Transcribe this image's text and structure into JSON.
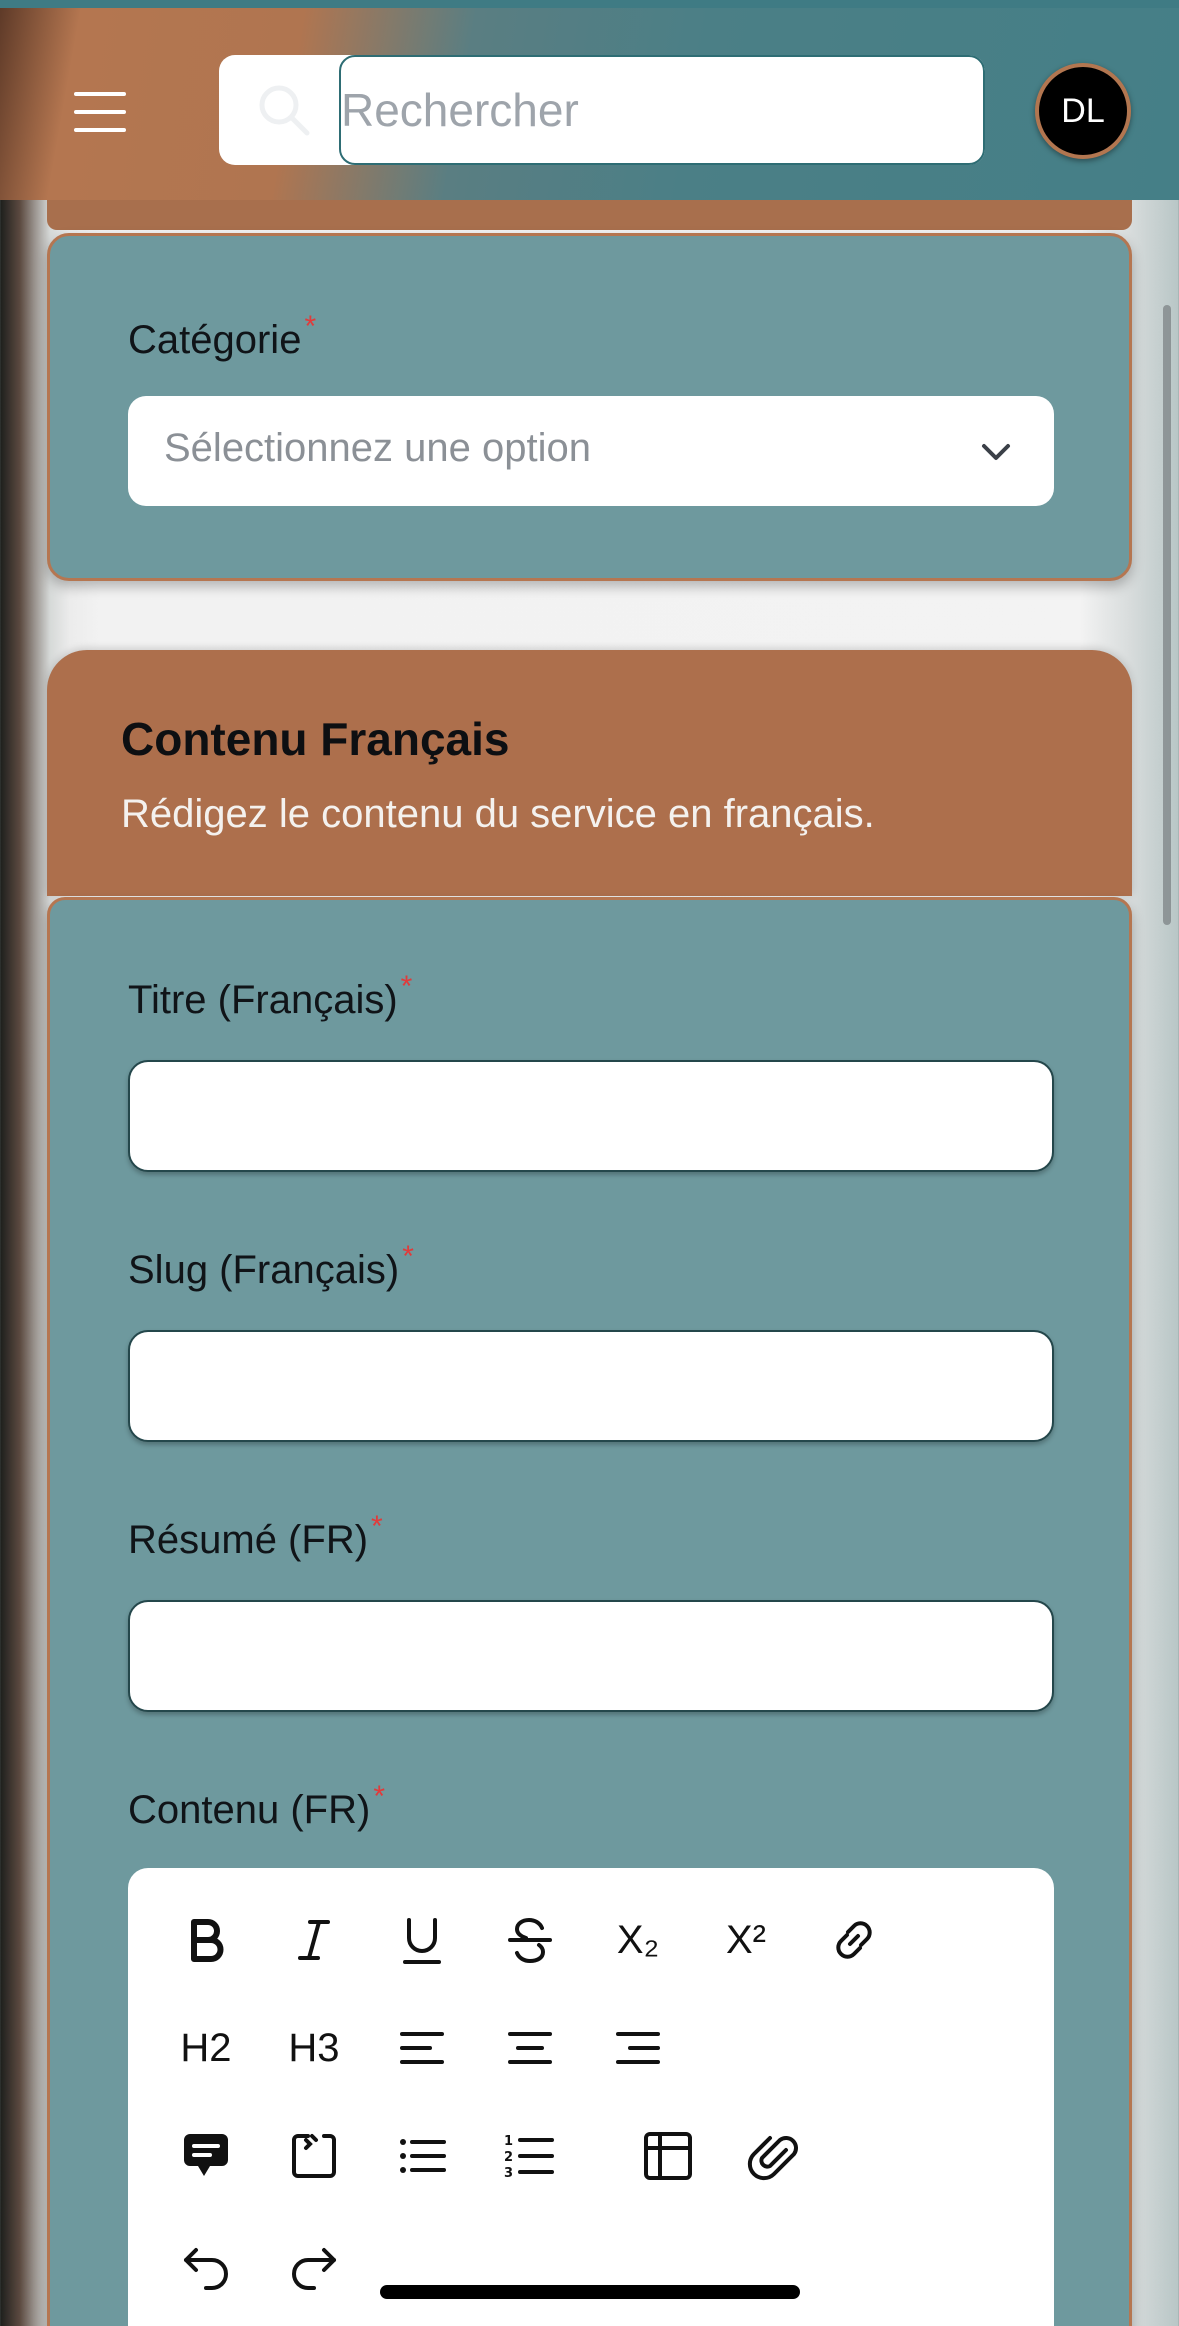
{
  "header": {
    "search_placeholder": "Rechercher",
    "avatar_initials": "DL"
  },
  "category": {
    "label": "Catégorie",
    "required_mark": "*",
    "select_placeholder": "Sélectionnez une option"
  },
  "section": {
    "title": "Contenu Français",
    "subtitle": "Rédigez le contenu du service en français."
  },
  "fields": {
    "title_label": "Titre (Français)",
    "slug_label": "Slug (Français)",
    "summary_label": "Résumé (FR)",
    "content_label": "Contenu (FR)",
    "required_mark": "*"
  },
  "toolbar": {
    "h2_label": "H2",
    "h3_label": "H3",
    "subscript_label": "X₂",
    "superscript_label": "X²"
  },
  "colors": {
    "card_teal": "#6e999e",
    "accent_copper": "#ad6f4c",
    "header_teal": "#457f87",
    "required_red": "#e03b3b"
  }
}
